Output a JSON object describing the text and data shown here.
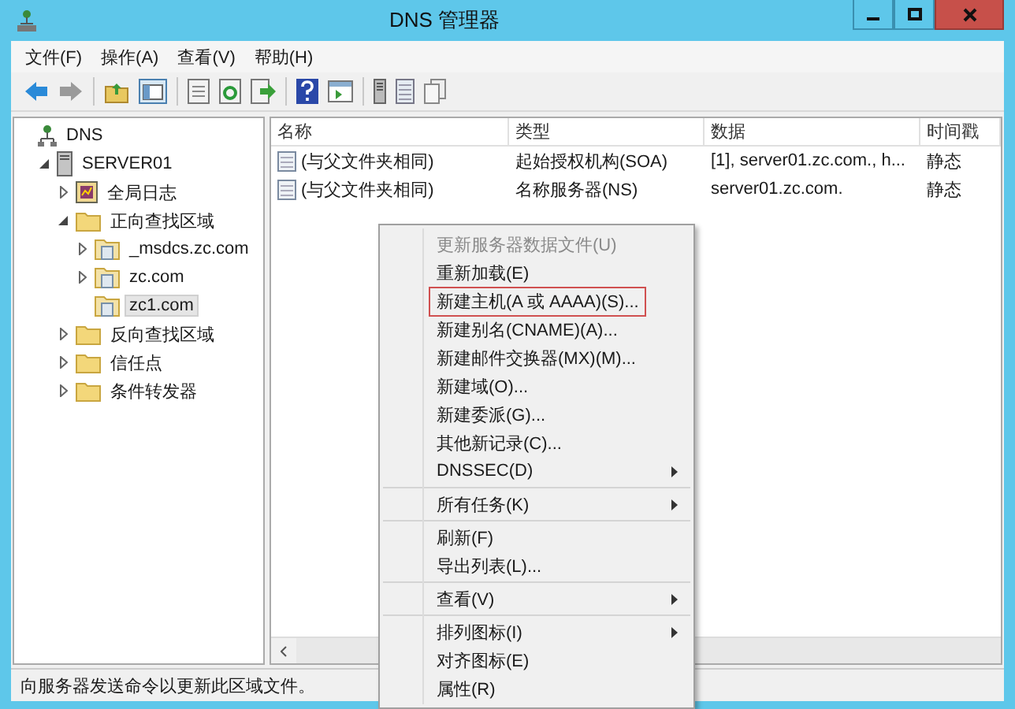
{
  "window": {
    "title": "DNS 管理器"
  },
  "menu_bar": [
    "文件(F)",
    "操作(A)",
    "查看(V)",
    "帮助(H)"
  ],
  "toolbar": {
    "back": {
      "disabled": false
    },
    "forward": {
      "disabled": true
    }
  },
  "tree": [
    {
      "label": "DNS",
      "kind": "root",
      "selected": false,
      "children": [
        {
          "label": "SERVER01",
          "kind": "server",
          "expanded": true,
          "selected": false,
          "children": [
            {
              "label": "全局日志",
              "kind": "log",
              "expanded": false,
              "selected": false
            },
            {
              "label": "正向查找区域",
              "kind": "folder",
              "expanded": true,
              "selected": false,
              "children": [
                {
                  "label": "_msdcs.zc.com",
                  "kind": "zone",
                  "expanded": false,
                  "selected": false
                },
                {
                  "label": "zc.com",
                  "kind": "zone",
                  "expanded": false,
                  "selected": false
                },
                {
                  "label": "zc1.com",
                  "kind": "zone",
                  "selected": true
                }
              ]
            },
            {
              "label": "反向查找区域",
              "kind": "folder",
              "expanded": false,
              "selected": false
            },
            {
              "label": "信任点",
              "kind": "folder",
              "expanded": false,
              "selected": false
            },
            {
              "label": "条件转发器",
              "kind": "folder",
              "expanded": false,
              "selected": false
            }
          ]
        }
      ]
    }
  ],
  "table": {
    "columns": [
      "名称",
      "类型",
      "数据",
      "时间戳"
    ],
    "rows": [
      {
        "cells": [
          "(与父文件夹相同)",
          "起始授权机构(SOA)",
          "[1], server01.zc.com., h...",
          "静态"
        ]
      },
      {
        "cells": [
          "(与父文件夹相同)",
          "名称服务器(NS)",
          "server01.zc.com.",
          "静态"
        ]
      }
    ]
  },
  "context_menu": {
    "sections": [
      [
        {
          "label": "更新服务器数据文件(U)",
          "disabled": true,
          "submenu": false,
          "outlined": false
        },
        {
          "label": "重新加载(E)",
          "disabled": false,
          "submenu": false,
          "outlined": false
        },
        {
          "label": "新建主机(A 或 AAAA)(S)...",
          "disabled": false,
          "submenu": false,
          "outlined": true
        },
        {
          "label": "新建别名(CNAME)(A)...",
          "disabled": false,
          "submenu": false,
          "outlined": false
        },
        {
          "label": "新建邮件交换器(MX)(M)...",
          "disabled": false,
          "submenu": false,
          "outlined": false
        },
        {
          "label": "新建域(O)...",
          "disabled": false,
          "submenu": false,
          "outlined": false
        },
        {
          "label": "新建委派(G)...",
          "disabled": false,
          "submenu": false,
          "outlined": false
        },
        {
          "label": "其他新记录(C)...",
          "disabled": false,
          "submenu": false,
          "outlined": false
        },
        {
          "label": "DNSSEC(D)",
          "disabled": false,
          "submenu": true,
          "outlined": false
        }
      ],
      [
        {
          "label": "所有任务(K)",
          "disabled": false,
          "submenu": true,
          "outlined": false
        }
      ],
      [
        {
          "label": "刷新(F)",
          "disabled": false,
          "submenu": false,
          "outlined": false
        },
        {
          "label": "导出列表(L)...",
          "disabled": false,
          "submenu": false,
          "outlined": false
        }
      ],
      [
        {
          "label": "查看(V)",
          "disabled": false,
          "submenu": true,
          "outlined": false
        }
      ],
      [
        {
          "label": "排列图标(I)",
          "disabled": false,
          "submenu": true,
          "outlined": false
        },
        {
          "label": "对齐图标(E)",
          "disabled": false,
          "submenu": false,
          "outlined": false
        },
        {
          "label": "属性(R)",
          "disabled": false,
          "submenu": false,
          "outlined": false
        }
      ]
    ]
  },
  "status_bar": "向服务器发送命令以更新此区域文件。"
}
